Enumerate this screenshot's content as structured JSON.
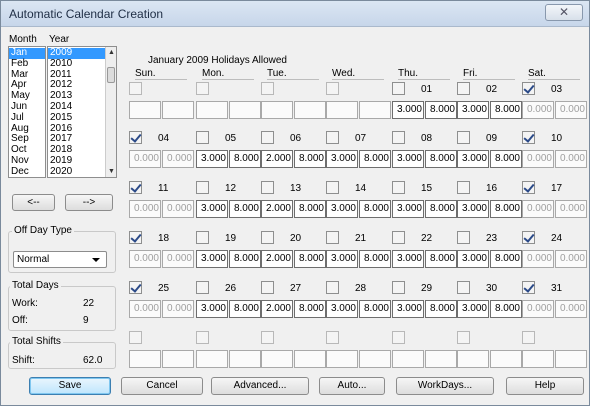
{
  "window": {
    "title": "Automatic Calendar Creation",
    "close_glyph": "✕"
  },
  "left": {
    "month_label": "Month",
    "year_label": "Year",
    "months": [
      "Jan",
      "Feb",
      "Mar",
      "Apr",
      "May",
      "Jun",
      "Jul",
      "Aug",
      "Sep",
      "Oct",
      "Nov",
      "Dec"
    ],
    "selected_month": "Jan",
    "years": [
      "2009",
      "2010",
      "2011",
      "2012",
      "2013",
      "2014",
      "2015",
      "2016",
      "2017",
      "2018",
      "2019",
      "2020"
    ],
    "selected_year": "2009",
    "prev_label": "<--",
    "next_label": "-->",
    "off_day_type_label": "Off Day Type",
    "off_day_type_value": "Normal",
    "total_days_label": "Total Days",
    "work_label": "Work:",
    "work_value": "22",
    "off_label": "Off:",
    "off_value": "9",
    "total_shifts_label": "Total Shifts",
    "shift_label": "Shift:",
    "shift_value": "62.0"
  },
  "calendar": {
    "title": "January 2009 Holidays Allowed",
    "weekdays": [
      "Sun.",
      "Mon.",
      "Tue.",
      "Wed.",
      "Thu.",
      "Fri.",
      "Sat."
    ],
    "weeks": [
      [
        {
          "d": "",
          "c": false,
          "a": "",
          "b": "",
          "e": false
        },
        {
          "d": "",
          "c": false,
          "a": "",
          "b": "",
          "e": false
        },
        {
          "d": "",
          "c": false,
          "a": "",
          "b": "",
          "e": false
        },
        {
          "d": "",
          "c": false,
          "a": "",
          "b": "",
          "e": false
        },
        {
          "d": "01",
          "c": false,
          "a": "3.000",
          "b": "8.000",
          "e": true
        },
        {
          "d": "02",
          "c": false,
          "a": "3.000",
          "b": "8.000",
          "e": true
        },
        {
          "d": "03",
          "c": true,
          "a": "0.000",
          "b": "0.000",
          "e": false
        }
      ],
      [
        {
          "d": "04",
          "c": true,
          "a": "0.000",
          "b": "0.000",
          "e": false
        },
        {
          "d": "05",
          "c": false,
          "a": "3.000",
          "b": "8.000",
          "e": true
        },
        {
          "d": "06",
          "c": false,
          "a": "2.000",
          "b": "8.000",
          "e": true
        },
        {
          "d": "07",
          "c": false,
          "a": "3.000",
          "b": "8.000",
          "e": true
        },
        {
          "d": "08",
          "c": false,
          "a": "3.000",
          "b": "8.000",
          "e": true
        },
        {
          "d": "09",
          "c": false,
          "a": "3.000",
          "b": "8.000",
          "e": true
        },
        {
          "d": "10",
          "c": true,
          "a": "0.000",
          "b": "0.000",
          "e": false
        }
      ],
      [
        {
          "d": "11",
          "c": true,
          "a": "0.000",
          "b": "0.000",
          "e": false
        },
        {
          "d": "12",
          "c": false,
          "a": "3.000",
          "b": "8.000",
          "e": true
        },
        {
          "d": "13",
          "c": false,
          "a": "2.000",
          "b": "8.000",
          "e": true
        },
        {
          "d": "14",
          "c": false,
          "a": "3.000",
          "b": "8.000",
          "e": true
        },
        {
          "d": "15",
          "c": false,
          "a": "3.000",
          "b": "8.000",
          "e": true
        },
        {
          "d": "16",
          "c": false,
          "a": "3.000",
          "b": "8.000",
          "e": true
        },
        {
          "d": "17",
          "c": true,
          "a": "0.000",
          "b": "0.000",
          "e": false
        }
      ],
      [
        {
          "d": "18",
          "c": true,
          "a": "0.000",
          "b": "0.000",
          "e": false
        },
        {
          "d": "19",
          "c": false,
          "a": "3.000",
          "b": "8.000",
          "e": true
        },
        {
          "d": "20",
          "c": false,
          "a": "2.000",
          "b": "8.000",
          "e": true
        },
        {
          "d": "21",
          "c": false,
          "a": "3.000",
          "b": "8.000",
          "e": true
        },
        {
          "d": "22",
          "c": false,
          "a": "3.000",
          "b": "8.000",
          "e": true
        },
        {
          "d": "23",
          "c": false,
          "a": "3.000",
          "b": "8.000",
          "e": true
        },
        {
          "d": "24",
          "c": true,
          "a": "0.000",
          "b": "0.000",
          "e": false
        }
      ],
      [
        {
          "d": "25",
          "c": true,
          "a": "0.000",
          "b": "0.000",
          "e": false
        },
        {
          "d": "26",
          "c": false,
          "a": "3.000",
          "b": "8.000",
          "e": true
        },
        {
          "d": "27",
          "c": false,
          "a": "2.000",
          "b": "8.000",
          "e": true
        },
        {
          "d": "28",
          "c": false,
          "a": "3.000",
          "b": "8.000",
          "e": true
        },
        {
          "d": "29",
          "c": false,
          "a": "3.000",
          "b": "8.000",
          "e": true
        },
        {
          "d": "30",
          "c": false,
          "a": "3.000",
          "b": "8.000",
          "e": true
        },
        {
          "d": "31",
          "c": true,
          "a": "0.000",
          "b": "0.000",
          "e": false
        }
      ],
      [
        {
          "d": "",
          "c": false,
          "a": "",
          "b": "",
          "e": false
        },
        {
          "d": "",
          "c": false,
          "a": "",
          "b": "",
          "e": false
        },
        {
          "d": "",
          "c": false,
          "a": "",
          "b": "",
          "e": false
        },
        {
          "d": "",
          "c": false,
          "a": "",
          "b": "",
          "e": false
        },
        {
          "d": "",
          "c": false,
          "a": "",
          "b": "",
          "e": false
        },
        {
          "d": "",
          "c": false,
          "a": "",
          "b": "",
          "e": false
        },
        {
          "d": "",
          "c": false,
          "a": "",
          "b": "",
          "e": false
        }
      ]
    ]
  },
  "buttons": {
    "save": "Save",
    "cancel": "Cancel",
    "advanced": "Advanced...",
    "auto": "Auto...",
    "workdays": "WorkDays...",
    "help": "Help"
  }
}
